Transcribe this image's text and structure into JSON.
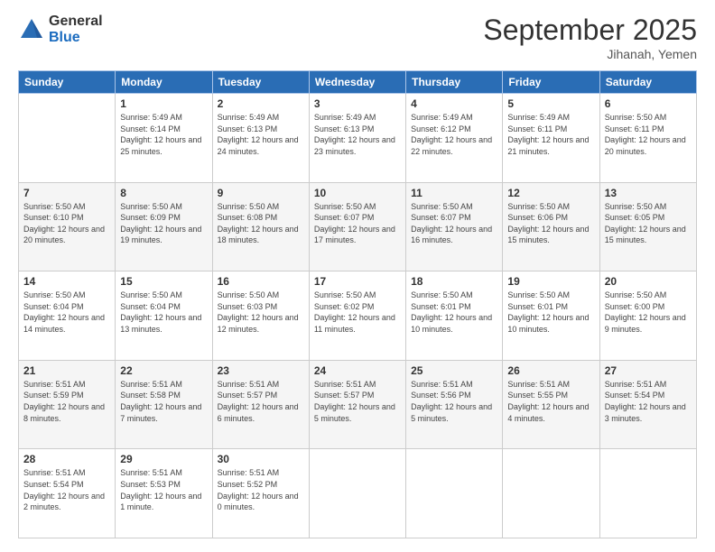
{
  "header": {
    "logo_general": "General",
    "logo_blue": "Blue",
    "month_title": "September 2025",
    "location": "Jihanah, Yemen"
  },
  "days_of_week": [
    "Sunday",
    "Monday",
    "Tuesday",
    "Wednesday",
    "Thursday",
    "Friday",
    "Saturday"
  ],
  "weeks": [
    [
      {
        "day": "",
        "sunrise": "",
        "sunset": "",
        "daylight": ""
      },
      {
        "day": "1",
        "sunrise": "Sunrise: 5:49 AM",
        "sunset": "Sunset: 6:14 PM",
        "daylight": "Daylight: 12 hours and 25 minutes."
      },
      {
        "day": "2",
        "sunrise": "Sunrise: 5:49 AM",
        "sunset": "Sunset: 6:13 PM",
        "daylight": "Daylight: 12 hours and 24 minutes."
      },
      {
        "day": "3",
        "sunrise": "Sunrise: 5:49 AM",
        "sunset": "Sunset: 6:13 PM",
        "daylight": "Daylight: 12 hours and 23 minutes."
      },
      {
        "day": "4",
        "sunrise": "Sunrise: 5:49 AM",
        "sunset": "Sunset: 6:12 PM",
        "daylight": "Daylight: 12 hours and 22 minutes."
      },
      {
        "day": "5",
        "sunrise": "Sunrise: 5:49 AM",
        "sunset": "Sunset: 6:11 PM",
        "daylight": "Daylight: 12 hours and 21 minutes."
      },
      {
        "day": "6",
        "sunrise": "Sunrise: 5:50 AM",
        "sunset": "Sunset: 6:11 PM",
        "daylight": "Daylight: 12 hours and 20 minutes."
      }
    ],
    [
      {
        "day": "7",
        "sunrise": "Sunrise: 5:50 AM",
        "sunset": "Sunset: 6:10 PM",
        "daylight": "Daylight: 12 hours and 20 minutes."
      },
      {
        "day": "8",
        "sunrise": "Sunrise: 5:50 AM",
        "sunset": "Sunset: 6:09 PM",
        "daylight": "Daylight: 12 hours and 19 minutes."
      },
      {
        "day": "9",
        "sunrise": "Sunrise: 5:50 AM",
        "sunset": "Sunset: 6:08 PM",
        "daylight": "Daylight: 12 hours and 18 minutes."
      },
      {
        "day": "10",
        "sunrise": "Sunrise: 5:50 AM",
        "sunset": "Sunset: 6:07 PM",
        "daylight": "Daylight: 12 hours and 17 minutes."
      },
      {
        "day": "11",
        "sunrise": "Sunrise: 5:50 AM",
        "sunset": "Sunset: 6:07 PM",
        "daylight": "Daylight: 12 hours and 16 minutes."
      },
      {
        "day": "12",
        "sunrise": "Sunrise: 5:50 AM",
        "sunset": "Sunset: 6:06 PM",
        "daylight": "Daylight: 12 hours and 15 minutes."
      },
      {
        "day": "13",
        "sunrise": "Sunrise: 5:50 AM",
        "sunset": "Sunset: 6:05 PM",
        "daylight": "Daylight: 12 hours and 15 minutes."
      }
    ],
    [
      {
        "day": "14",
        "sunrise": "Sunrise: 5:50 AM",
        "sunset": "Sunset: 6:04 PM",
        "daylight": "Daylight: 12 hours and 14 minutes."
      },
      {
        "day": "15",
        "sunrise": "Sunrise: 5:50 AM",
        "sunset": "Sunset: 6:04 PM",
        "daylight": "Daylight: 12 hours and 13 minutes."
      },
      {
        "day": "16",
        "sunrise": "Sunrise: 5:50 AM",
        "sunset": "Sunset: 6:03 PM",
        "daylight": "Daylight: 12 hours and 12 minutes."
      },
      {
        "day": "17",
        "sunrise": "Sunrise: 5:50 AM",
        "sunset": "Sunset: 6:02 PM",
        "daylight": "Daylight: 12 hours and 11 minutes."
      },
      {
        "day": "18",
        "sunrise": "Sunrise: 5:50 AM",
        "sunset": "Sunset: 6:01 PM",
        "daylight": "Daylight: 12 hours and 10 minutes."
      },
      {
        "day": "19",
        "sunrise": "Sunrise: 5:50 AM",
        "sunset": "Sunset: 6:01 PM",
        "daylight": "Daylight: 12 hours and 10 minutes."
      },
      {
        "day": "20",
        "sunrise": "Sunrise: 5:50 AM",
        "sunset": "Sunset: 6:00 PM",
        "daylight": "Daylight: 12 hours and 9 minutes."
      }
    ],
    [
      {
        "day": "21",
        "sunrise": "Sunrise: 5:51 AM",
        "sunset": "Sunset: 5:59 PM",
        "daylight": "Daylight: 12 hours and 8 minutes."
      },
      {
        "day": "22",
        "sunrise": "Sunrise: 5:51 AM",
        "sunset": "Sunset: 5:58 PM",
        "daylight": "Daylight: 12 hours and 7 minutes."
      },
      {
        "day": "23",
        "sunrise": "Sunrise: 5:51 AM",
        "sunset": "Sunset: 5:57 PM",
        "daylight": "Daylight: 12 hours and 6 minutes."
      },
      {
        "day": "24",
        "sunrise": "Sunrise: 5:51 AM",
        "sunset": "Sunset: 5:57 PM",
        "daylight": "Daylight: 12 hours and 5 minutes."
      },
      {
        "day": "25",
        "sunrise": "Sunrise: 5:51 AM",
        "sunset": "Sunset: 5:56 PM",
        "daylight": "Daylight: 12 hours and 5 minutes."
      },
      {
        "day": "26",
        "sunrise": "Sunrise: 5:51 AM",
        "sunset": "Sunset: 5:55 PM",
        "daylight": "Daylight: 12 hours and 4 minutes."
      },
      {
        "day": "27",
        "sunrise": "Sunrise: 5:51 AM",
        "sunset": "Sunset: 5:54 PM",
        "daylight": "Daylight: 12 hours and 3 minutes."
      }
    ],
    [
      {
        "day": "28",
        "sunrise": "Sunrise: 5:51 AM",
        "sunset": "Sunset: 5:54 PM",
        "daylight": "Daylight: 12 hours and 2 minutes."
      },
      {
        "day": "29",
        "sunrise": "Sunrise: 5:51 AM",
        "sunset": "Sunset: 5:53 PM",
        "daylight": "Daylight: 12 hours and 1 minute."
      },
      {
        "day": "30",
        "sunrise": "Sunrise: 5:51 AM",
        "sunset": "Sunset: 5:52 PM",
        "daylight": "Daylight: 12 hours and 0 minutes."
      },
      {
        "day": "",
        "sunrise": "",
        "sunset": "",
        "daylight": ""
      },
      {
        "day": "",
        "sunrise": "",
        "sunset": "",
        "daylight": ""
      },
      {
        "day": "",
        "sunrise": "",
        "sunset": "",
        "daylight": ""
      },
      {
        "day": "",
        "sunrise": "",
        "sunset": "",
        "daylight": ""
      }
    ]
  ]
}
